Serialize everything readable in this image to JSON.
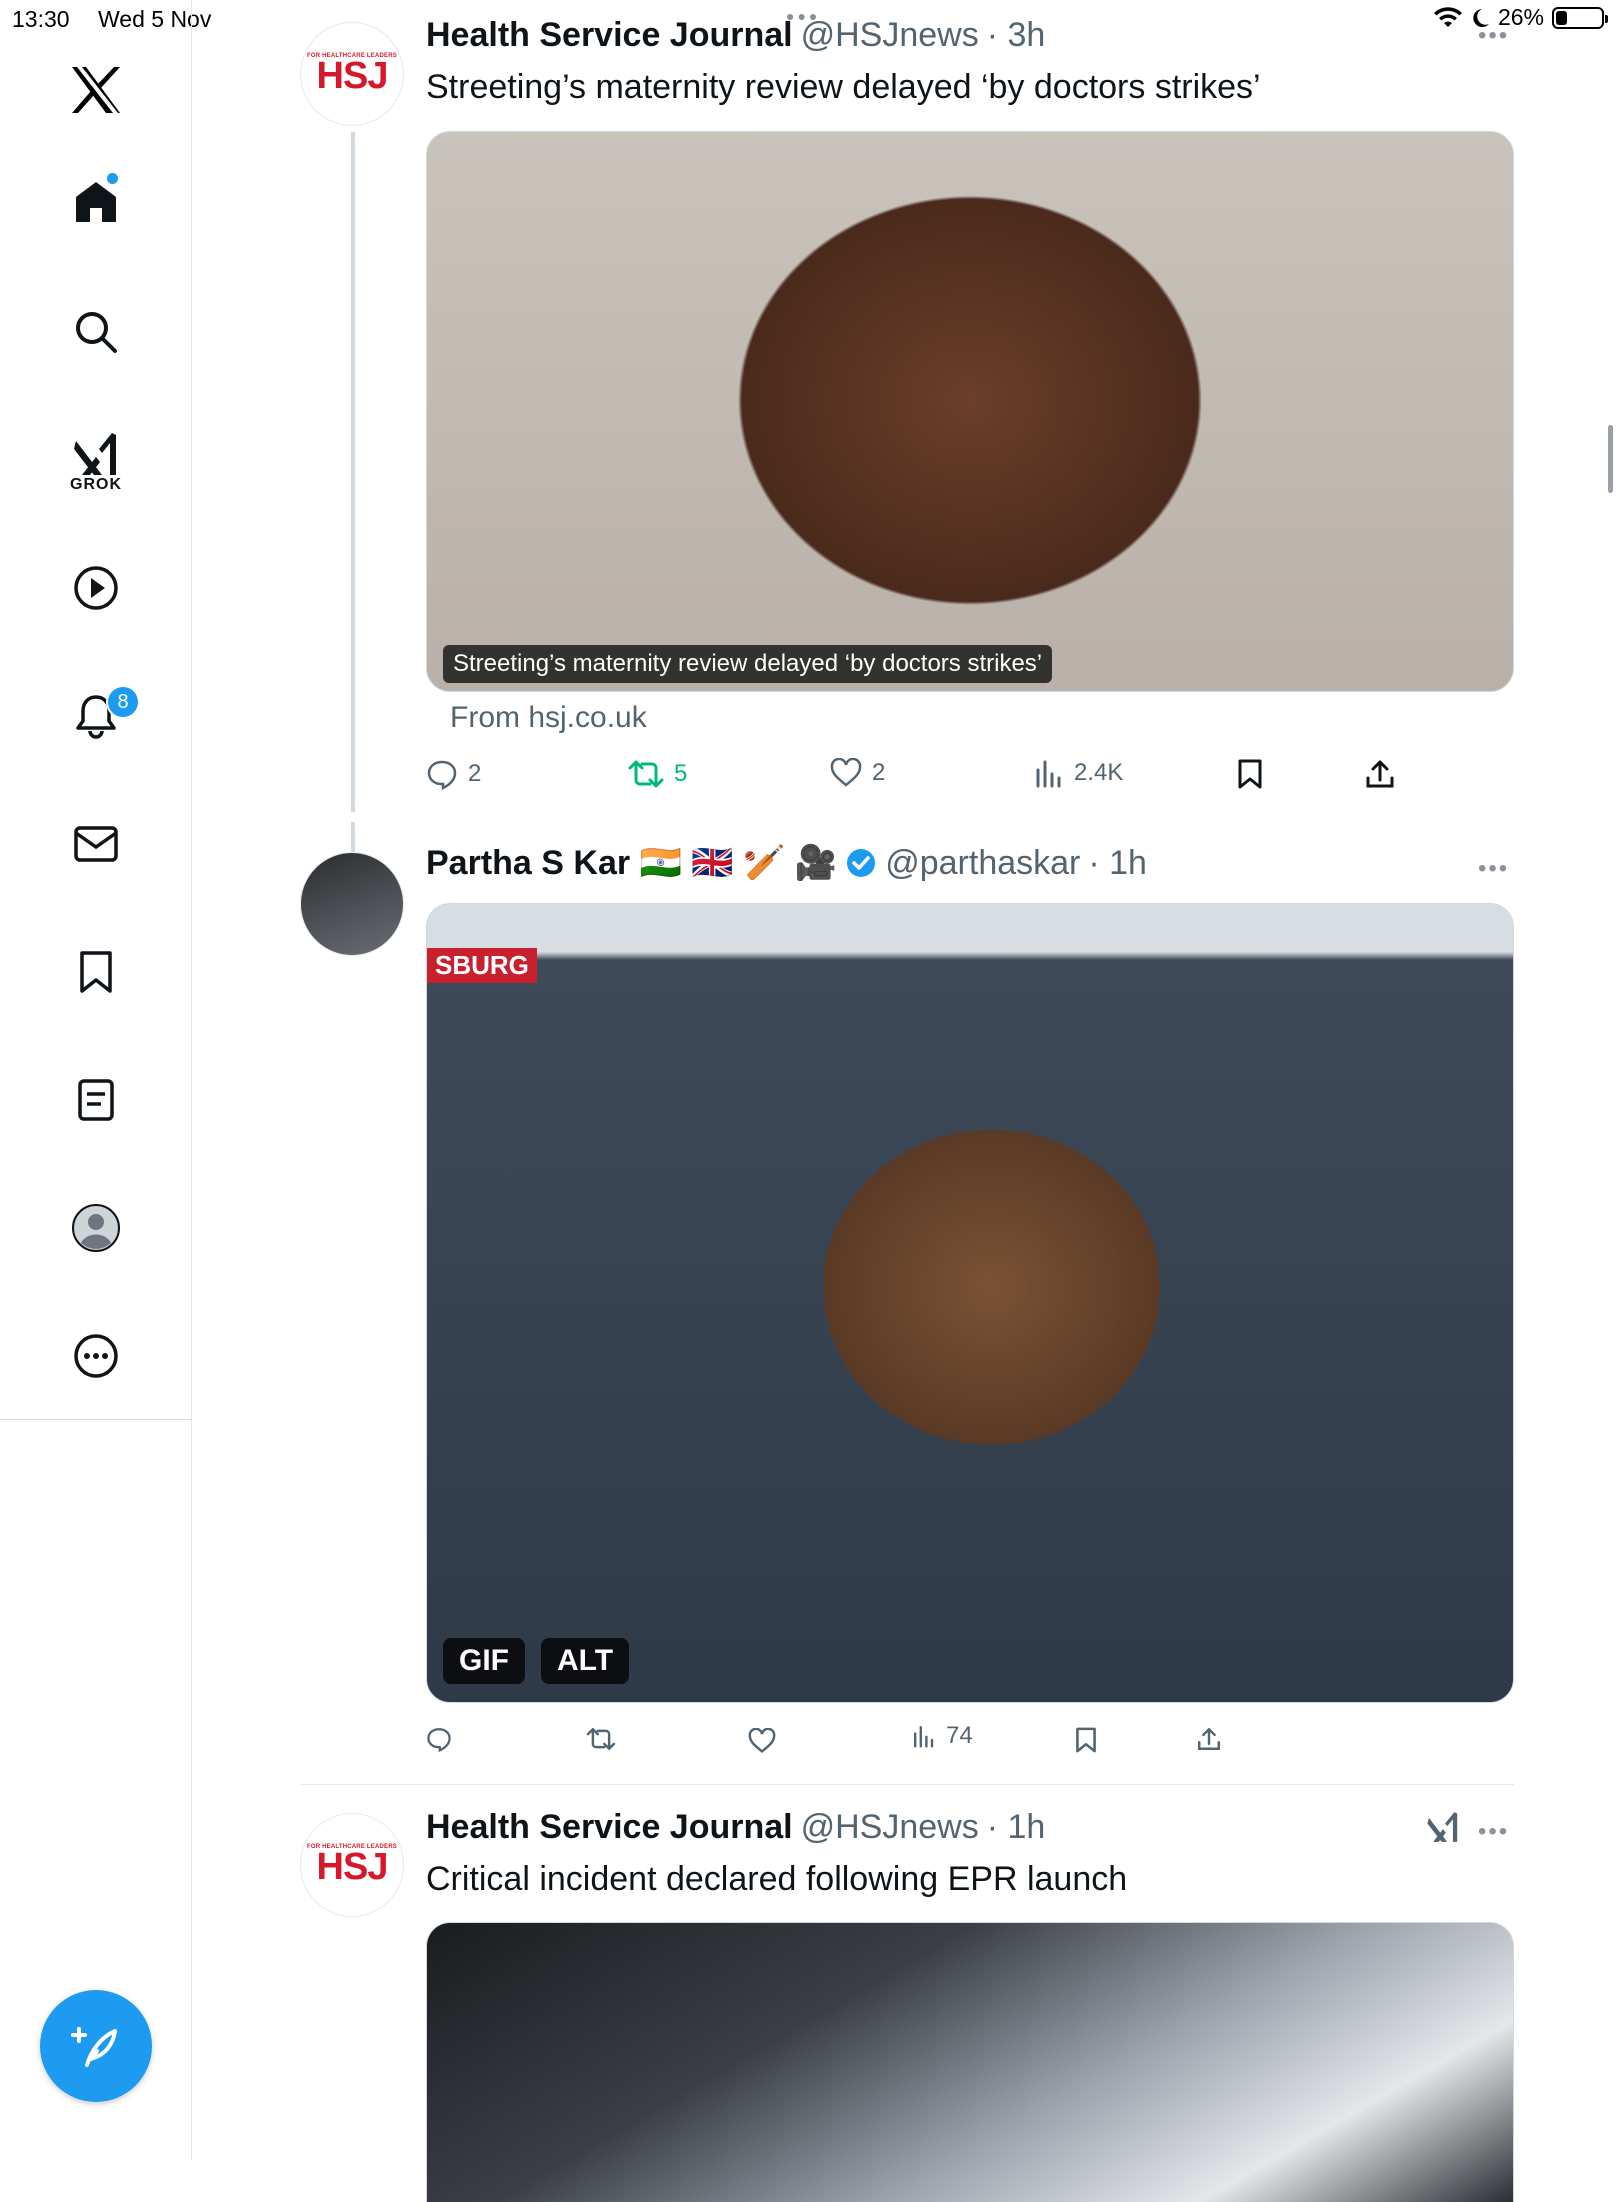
{
  "status_bar": {
    "time": "13:30",
    "date": "Wed 5 Nov",
    "battery": "26%",
    "battery_level": 0.26
  },
  "sidebar": {
    "items": [
      {
        "id": "home",
        "icon": "home-icon"
      },
      {
        "id": "explore",
        "icon": "search-icon"
      },
      {
        "id": "grok",
        "icon": "grok-icon",
        "label": "GROK"
      },
      {
        "id": "video",
        "icon": "play-icon"
      },
      {
        "id": "notifications",
        "icon": "bell-icon",
        "badge": "8"
      },
      {
        "id": "messages",
        "icon": "envelope-icon"
      },
      {
        "id": "bookmarks",
        "icon": "bookmark-icon"
      },
      {
        "id": "lists",
        "icon": "list-icon"
      },
      {
        "id": "profile",
        "icon": "profile-icon"
      },
      {
        "id": "more",
        "icon": "more-icon"
      }
    ],
    "compose_icon": "compose-icon"
  },
  "tweets": [
    {
      "name": "Health Service Journal",
      "handle": "@HSJnews",
      "time": "· 3h",
      "text": "Streeting’s maternity review delayed ‘by doctors strikes’",
      "media_caption": "Streeting’s maternity review delayed ‘by doctors strikes’",
      "link_source": "From hsj.co.uk",
      "stats": {
        "replies": "2",
        "retweets": "5",
        "likes": "2",
        "views": "2.4K"
      },
      "avatar_logo": {
        "top": "FOR HEALTHCARE LEADERS",
        "main": "HSJ"
      }
    },
    {
      "name": "Partha S Kar 🇮🇳 🇬🇧 🏏 🎥",
      "handle": "@parthaskar",
      "time": "· 1h",
      "verified": true,
      "media_tag_gif": "GIF",
      "media_tag_alt": "ALT",
      "media_corner_text": "SBURG",
      "stats": {
        "views": "74"
      }
    },
    {
      "name": "Health Service Journal",
      "handle": "@HSJnews",
      "time": "· 1h",
      "text": "Critical incident declared following EPR launch",
      "avatar_logo": {
        "top": "FOR HEALTHCARE LEADERS",
        "main": "HSJ"
      }
    }
  ],
  "colors": {
    "accent": "#1d9bf0",
    "retweet_green": "#00ba7c",
    "hsj_red": "#d7182a"
  }
}
